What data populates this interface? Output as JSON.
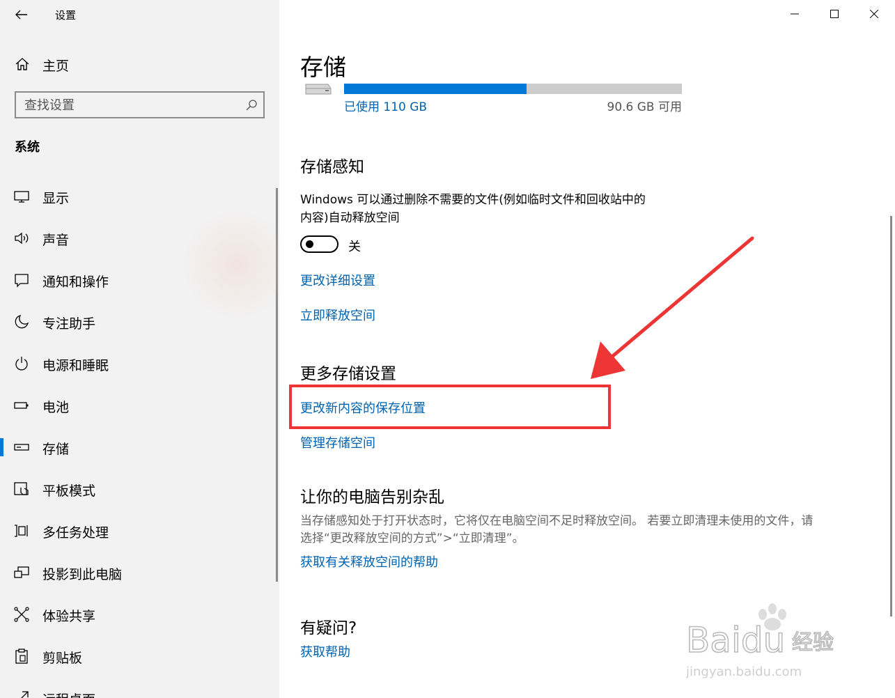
{
  "window": {
    "title": "设置",
    "controls": {
      "minimize": "minimize-icon",
      "maximize": "maximize-icon",
      "close": "close-icon"
    }
  },
  "sidebar": {
    "home_label": "主页",
    "search_placeholder": "查找设置",
    "section_title": "系统",
    "items": [
      {
        "label": "显示",
        "icon": "display-icon"
      },
      {
        "label": "声音",
        "icon": "sound-icon"
      },
      {
        "label": "通知和操作",
        "icon": "notification-icon"
      },
      {
        "label": "专注助手",
        "icon": "moon-icon"
      },
      {
        "label": "电源和睡眠",
        "icon": "power-icon"
      },
      {
        "label": "电池",
        "icon": "battery-icon"
      },
      {
        "label": "存储",
        "icon": "storage-icon",
        "active": true
      },
      {
        "label": "平板模式",
        "icon": "tablet-icon"
      },
      {
        "label": "多任务处理",
        "icon": "multitask-icon"
      },
      {
        "label": "投影到此电脑",
        "icon": "project-icon"
      },
      {
        "label": "体验共享",
        "icon": "share-icon"
      },
      {
        "label": "剪贴板",
        "icon": "clipboard-icon"
      },
      {
        "label": "远程桌面",
        "icon": "remote-desktop-icon"
      }
    ]
  },
  "main": {
    "page_title": "存储",
    "drive": {
      "used_label": "已使用 110 GB",
      "free_label": "90.6 GB 可用",
      "used_fraction": 0.54,
      "colors": {
        "used": "#0078d7",
        "free": "#cccccc"
      }
    },
    "storage_sense": {
      "heading": "存储感知",
      "description_line1": "Windows 可以通过删除不需要的文件(例如临时文件和回收站中的",
      "description_line2": "内容)自动释放空间",
      "toggle_state_label": "关",
      "link_change_settings": "更改详细设置",
      "link_free_now": "立即释放空间"
    },
    "more_storage": {
      "heading": "更多存储设置",
      "link_save_location": "更改新内容的保存位置",
      "link_manage_spaces": "管理存储空间"
    },
    "declutter": {
      "heading": "让你的电脑告别杂乱",
      "description_line1": "当存储感知处于打开状态时，它将仅在电脑空间不足时释放空间。 若要立即清理未使用的文件，请",
      "description_line2": "选择“更改释放空间的方式”>“立即清理”。",
      "link_help": "获取有关释放空间的帮助"
    },
    "questions": {
      "heading": "有疑问?",
      "link_help": "获取帮助"
    }
  },
  "annotation": {
    "highlight_color": "#ee3535"
  },
  "watermark": {
    "brand": "Baidu",
    "brand_cn": "经验",
    "url": "jingyan.baidu.com"
  }
}
